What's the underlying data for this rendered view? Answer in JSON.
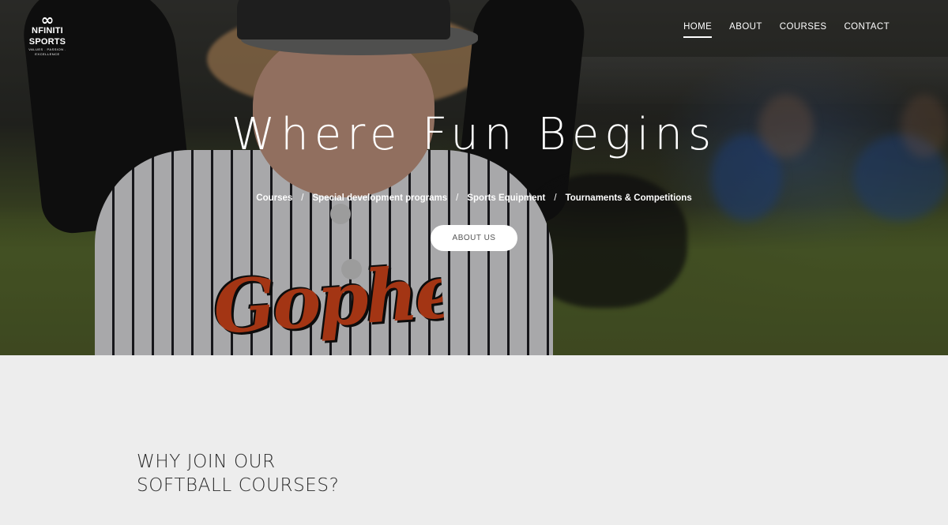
{
  "header": {
    "logo": {
      "mark": "∞",
      "name": "NFINITI SPORTS",
      "tagline": "VALUES . PASSION . EXCELLENCE"
    },
    "nav": [
      {
        "label": "HOME",
        "active": true
      },
      {
        "label": "ABOUT",
        "active": false
      },
      {
        "label": "COURSES",
        "active": false
      },
      {
        "label": "CONTACT",
        "active": false
      }
    ]
  },
  "hero": {
    "headline": "Where Fun Begins",
    "jersey_text": "Gophers",
    "links": [
      "Courses",
      "Special development programs",
      "Sports Equipment",
      "Tournaments & Competitions"
    ],
    "separator": "/",
    "cta_label": "ABOUT US"
  },
  "section": {
    "title_line1": "WHY JOIN OUR",
    "title_line2": "SOFTBALL COURSES?"
  },
  "colors": {
    "jersey_logo": "#e24a1c",
    "section_bg": "#ededed",
    "text_dark": "#2a2a2a"
  }
}
